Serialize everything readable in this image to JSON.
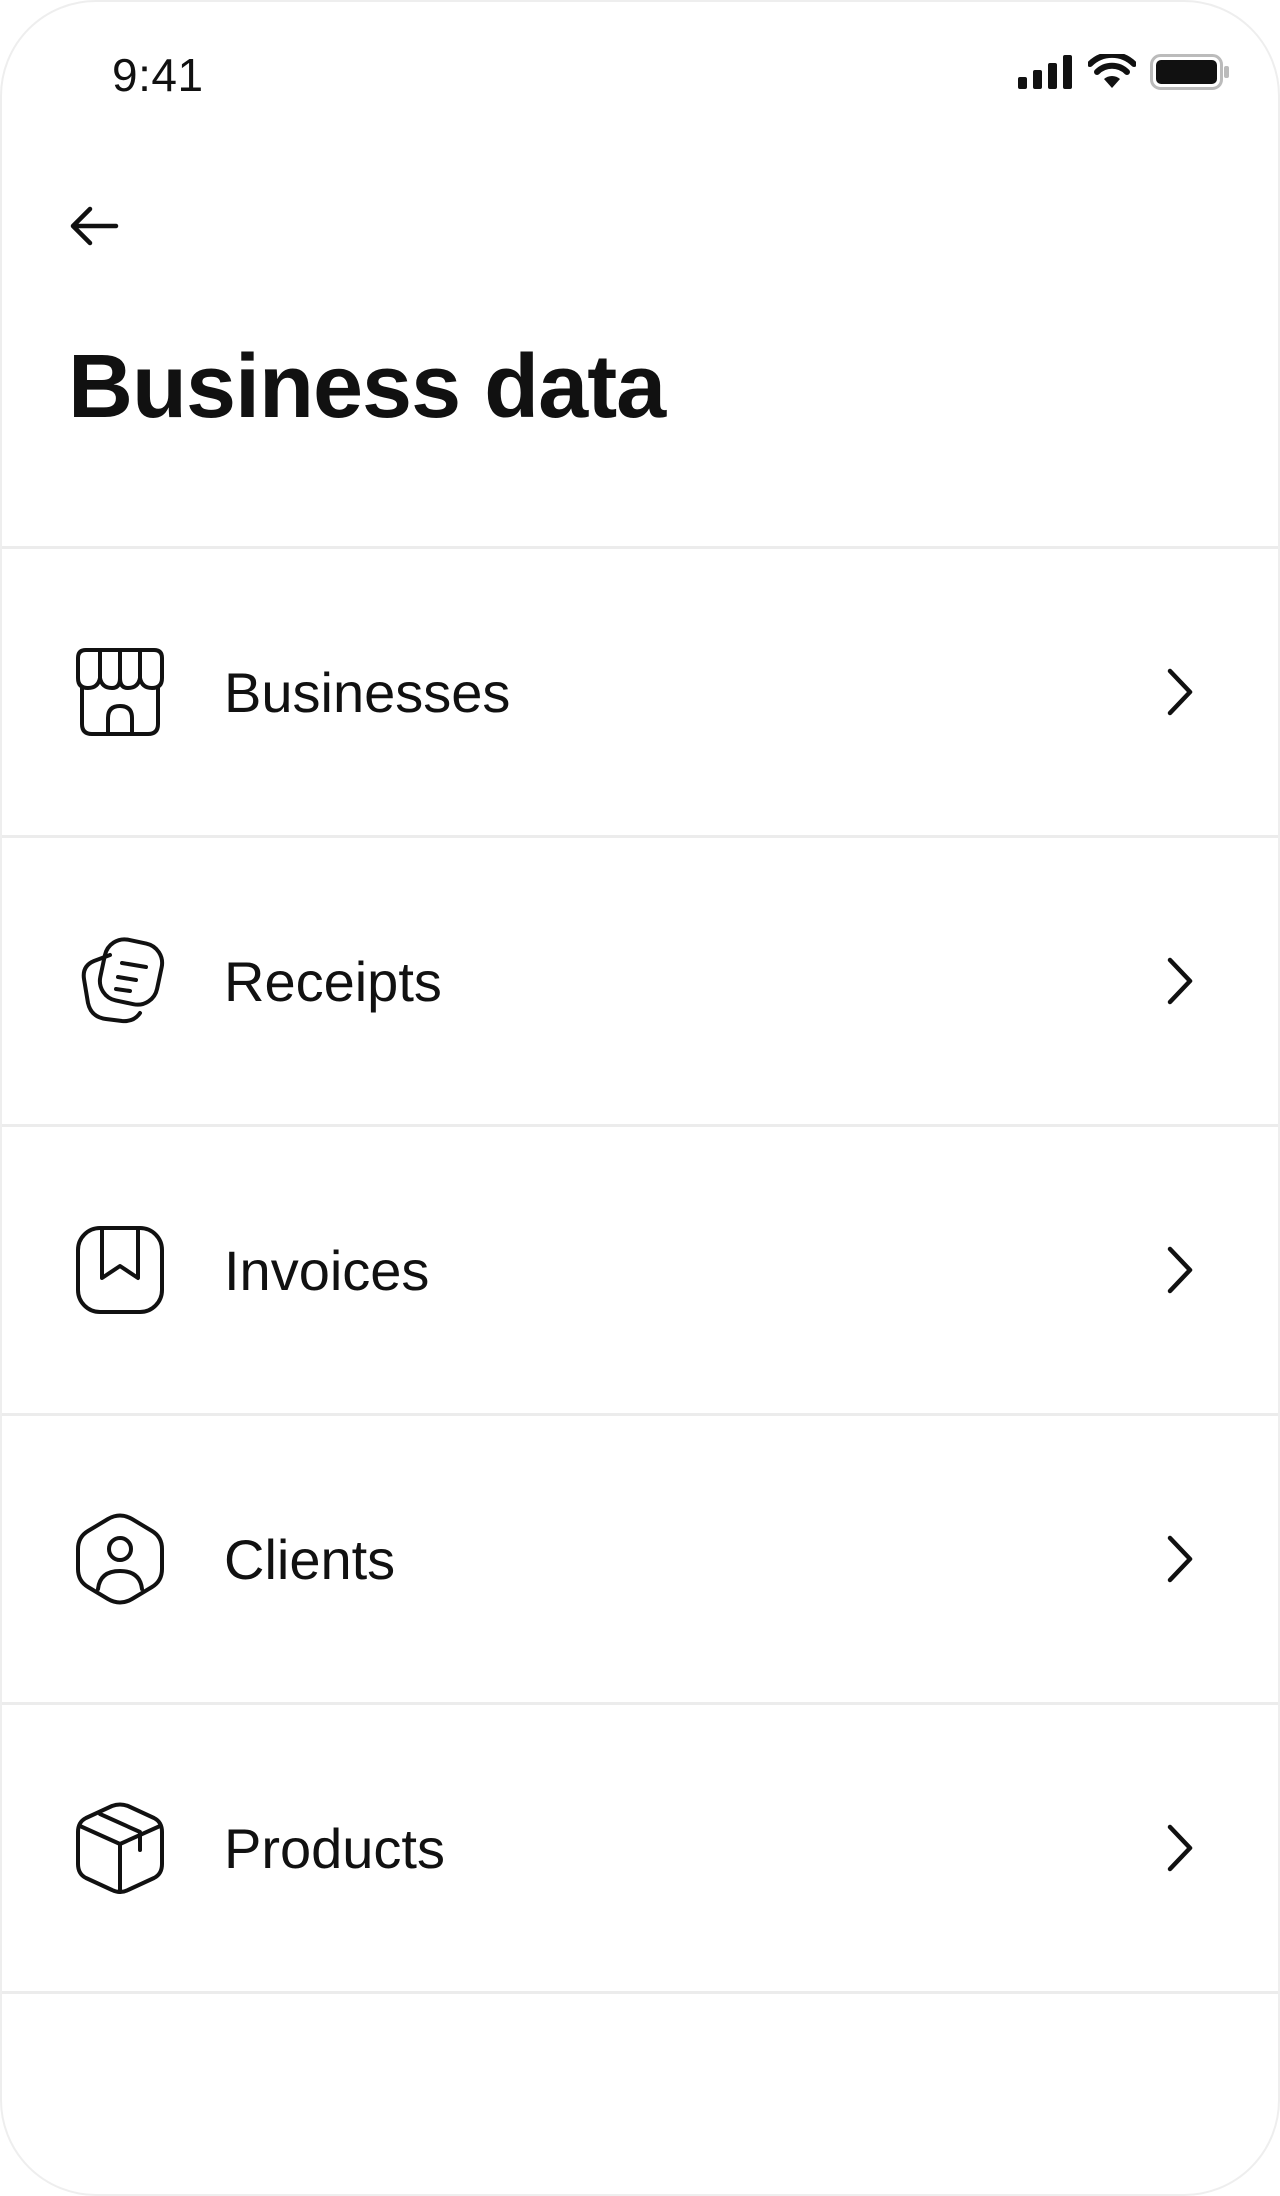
{
  "status_bar": {
    "time": "9:41",
    "icons": [
      "cellular-signal-icon",
      "wifi-icon",
      "battery-icon"
    ]
  },
  "header": {
    "back_icon": "arrow-left-icon",
    "title": "Business data"
  },
  "menu": {
    "items": [
      {
        "label": "Businesses",
        "icon": "storefront-icon"
      },
      {
        "label": "Receipts",
        "icon": "receipt-cards-icon"
      },
      {
        "label": "Invoices",
        "icon": "invoice-bookmark-icon"
      },
      {
        "label": "Clients",
        "icon": "user-hexagon-icon"
      },
      {
        "label": "Products",
        "icon": "package-box-icon"
      }
    ],
    "chevron_icon": "chevron-right-icon"
  },
  "colors": {
    "background": "#ffffff",
    "text": "#111111",
    "divider": "#ececec"
  }
}
